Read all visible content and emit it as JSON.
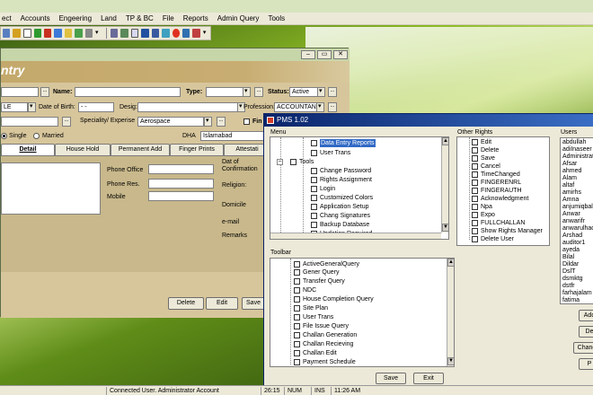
{
  "menubar": [
    "ect",
    "Accounts",
    "Engeering",
    "Land",
    "TP & BC",
    "File",
    "Reports",
    "Admin Query",
    "Tools"
  ],
  "entry": {
    "heading": "ntry",
    "name_label": "Name:",
    "type_label": "Type:",
    "status_label": "Status:",
    "status_value": "Active",
    "le_value": "LE",
    "dob_label": "Date of Birth:",
    "dob_value": "- -",
    "desig_label": "Desig:",
    "profession_label": "Profession:",
    "profession_value": "ACCOUNTANT",
    "speciality_label": "Speciality/ Experise",
    "speciality_value": "Aerospace",
    "fin_label": "Fin",
    "dha_label": "DHA",
    "dha_value": "Islamabad",
    "single_label": "Single",
    "married_label": "Married",
    "tabs": [
      "Detail",
      "House Hold",
      "Permanent Add",
      "Finger Prints",
      "Attestati"
    ],
    "phone_office_label": "Phone Office",
    "phone_res_label": "Phone Res.",
    "mobile_label": "Mobile",
    "dat_of_label": "Dat of",
    "confirmation_label": "Confirmation",
    "religion_label": "Religion:",
    "domicile_label": "Domicile",
    "email_label": "e-mail",
    "remarks_label": "Remarks",
    "delete_label": "Delete",
    "edit_label": "Edit",
    "save_label": "Save"
  },
  "pms": {
    "title": "PMS 1.02",
    "menu_label": "Menu",
    "other_rights_label": "Other Rights",
    "users_label": "Users",
    "toolbar_label": "Toolbar",
    "menu_items": [
      "Data Entry Reports",
      "User Trans",
      "Tools",
      "Change Password",
      "Rights Assignment",
      "Login",
      "Customized Colors",
      "Application Setup",
      "Chang Signatures",
      "Backup Database",
      "Updation Required"
    ],
    "other_rights": [
      "Edit",
      "Delete",
      "Save",
      "Cancel",
      "TimeChanged",
      "FINGERENRL",
      "FINGERAUTH",
      "Acknowledgment",
      "Npa",
      "Expo",
      "FULLCHALLAN",
      "Show Rights Manager",
      "Delete User"
    ],
    "users": [
      "abdullah",
      "adiInaseer",
      "Administrator",
      "Afsar",
      "ahmed",
      "Alam",
      "altaf",
      "amirhs",
      "Amna",
      "anjumiqbal",
      "Anwar",
      "anwarifr",
      "anwarulhaq",
      "Arshad",
      "auditor1",
      "ayeda",
      "Bilal",
      "Dildar",
      "DslT",
      "dsmktg",
      "dstfr",
      "farhajalam",
      "fatima"
    ],
    "toolbar_items": [
      "ActiveGeneralQuery",
      "Gener Query",
      "Transfer Query",
      "NDC",
      "House Completion Query",
      "Site Plan",
      "User Trans",
      "File Issue Query",
      "Challan Generation",
      "Challan Recieving",
      "Challan Edit",
      "Payment Schedule"
    ],
    "save_label": "Save",
    "exit_label": "Exit",
    "side_buttons": [
      "Add",
      "De",
      "Chang",
      "P"
    ]
  },
  "status": {
    "connected": "Connected User. Administrator Account",
    "time_short": "26:15",
    "num": "NUM",
    "ins": "INS",
    "clock": "11:26 AM"
  },
  "colors": {
    "titlebar_blue": "#0a246a",
    "form_tan": "#d7c69c",
    "desktop_green": "#8ab824"
  }
}
